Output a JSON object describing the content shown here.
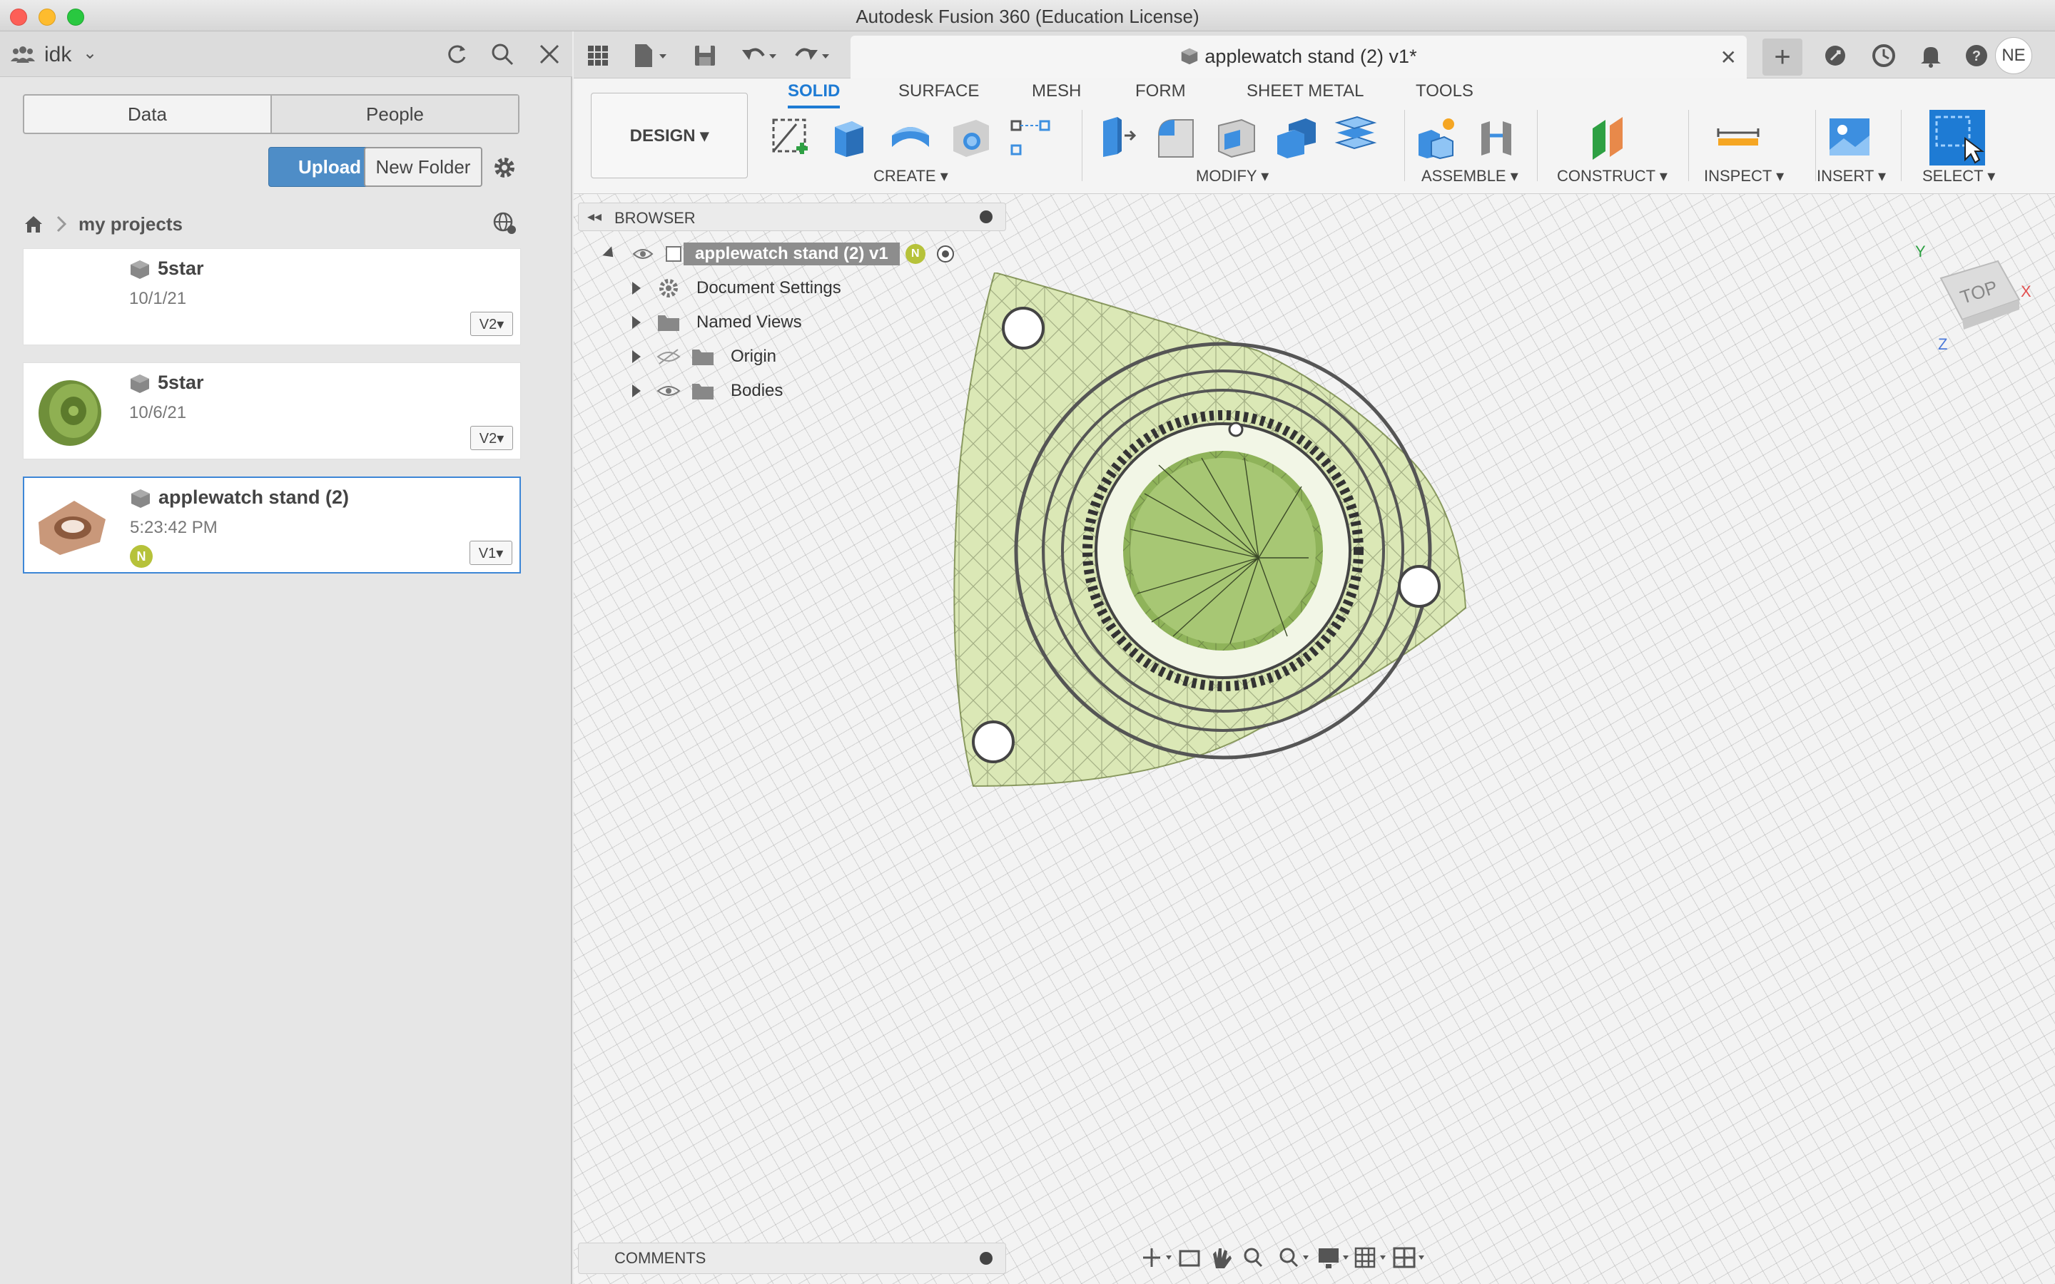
{
  "window": {
    "title": "Autodesk Fusion 360 (Education License)"
  },
  "data_panel": {
    "team_name": "idk",
    "tabs": [
      "Data",
      "People"
    ],
    "upload_label": "Upload",
    "new_folder_label": "New Folder",
    "breadcrumb": "my projects",
    "files": [
      {
        "name": "5star",
        "date": "10/1/21",
        "version": "V2▾",
        "has_thumb": false
      },
      {
        "name": "5star",
        "date": "10/6/21",
        "version": "V2▾",
        "has_thumb": true
      },
      {
        "name": "applewatch stand (2)",
        "date": "5:23:42 PM",
        "version": "V1▾",
        "has_thumb": true,
        "badge": "N",
        "selected": true
      }
    ]
  },
  "document_tab": {
    "title": "applewatch stand (2) v1*"
  },
  "user_initials": "NE",
  "ribbon": {
    "workspace": "DESIGN ▾",
    "tabs": [
      "SOLID",
      "SURFACE",
      "MESH",
      "FORM",
      "SHEET METAL",
      "TOOLS"
    ],
    "active_tab": "SOLID",
    "groups": [
      "CREATE ▾",
      "MODIFY ▾",
      "ASSEMBLE ▾",
      "CONSTRUCT ▾",
      "INSPECT ▾",
      "INSERT ▾",
      "SELECT ▾"
    ]
  },
  "browser": {
    "title": "BROWSER",
    "root": "applewatch stand (2) v1",
    "root_badge": "N",
    "items": [
      "Document Settings",
      "Named Views",
      "Origin",
      "Bodies"
    ]
  },
  "comments": {
    "title": "COMMENTS"
  },
  "viewcube": {
    "face": "TOP",
    "axes": [
      "Y",
      "X",
      "Z"
    ]
  },
  "colors": {
    "accent": "#1e7bd4",
    "upload": "#4e8dc7",
    "model_fill": "#dbe8b6"
  }
}
